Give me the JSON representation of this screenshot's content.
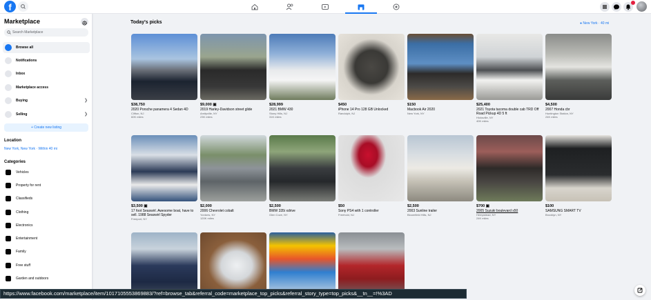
{
  "colors": {
    "brand": "#1877f2",
    "badge": "#e41e3f"
  },
  "topbar": {
    "logo": "f",
    "nav_icons": [
      "home-icon",
      "friends-icon",
      "watch-icon",
      "marketplace-icon",
      "gaming-icon"
    ],
    "right_icons": [
      "menu-icon",
      "messenger-icon",
      "notifications-icon",
      "profile-icon"
    ],
    "notification_count": "8"
  },
  "sidebar": {
    "title": "Marketplace",
    "search_placeholder": "Search Marketplace",
    "nav": [
      {
        "label": "Browse all",
        "active": true
      },
      {
        "label": "Notifications"
      },
      {
        "label": "Inbox"
      },
      {
        "label": "Marketplace access"
      },
      {
        "label": "Buying",
        "chevron": true
      },
      {
        "label": "Selling",
        "chevron": true
      }
    ],
    "create_label": "+ Create new listing",
    "location_heading": "Location",
    "location_value": "New York, New York · Within 40 mi",
    "categories_heading": "Categories",
    "categories": [
      "Vehicles",
      "Property for rent",
      "Classifieds",
      "Clothing",
      "Electronics",
      "Entertainment",
      "Family",
      "Free stuff",
      "Garden and outdoors"
    ]
  },
  "main": {
    "title": "Today's picks",
    "location_link": "New York · 40 mi",
    "listings": [
      {
        "price": "$38,750",
        "title": "2020 Porsche panamera 4 Sedan 4D",
        "location": "Clifton, NJ",
        "mileage": "60K miles"
      },
      {
        "price": "$9,000",
        "title": "2019 Harley-Davidson street glide",
        "location": "Amityville, NY",
        "mileage": "23K miles"
      },
      {
        "price": "$28,999",
        "title": "2021 BMW 430",
        "location": "Stony Hills, NJ",
        "mileage": "31K miles"
      },
      {
        "price": "$450",
        "title": "iPhone 14 Pro 128 GB Unlocked",
        "location": "Randolph, NJ",
        "mileage": ""
      },
      {
        "price": "$150",
        "title": "Macbook Air 2020",
        "location": "New York, NY",
        "mileage": ""
      },
      {
        "price": "$25,400",
        "title": "2021 Toyota tacoma double cab TRD Off Road Pickup 4D 5 ft",
        "location": "Hicksville, NY",
        "mileage": "40K miles"
      },
      {
        "price": "$4,500",
        "title": "2007 Honda cbr",
        "location": "Huntington Station, NY",
        "mileage": "24K miles"
      },
      {
        "price": "$3,500",
        "title": "17 foot Seaswirl. Awesome boat, have to sell. 1988 Seaswirl Spyder",
        "location": "Freeport, NY",
        "mileage": ""
      },
      {
        "price": "$2,000",
        "title": "2006 Chevrolet cobalt",
        "location": "Yonkers, NY",
        "mileage": "120K miles"
      },
      {
        "price": "$2,500",
        "title": "BMW 335i xdrive",
        "location": "Glen Cove, NY",
        "mileage": ""
      },
      {
        "price": "$50",
        "title": "Sony PS4 with 1 controller",
        "location": "Freehold, NJ",
        "mileage": ""
      },
      {
        "price": "$2,500",
        "title": "2003 Sunline trailer",
        "location": "Bloomfield Hills, NJ",
        "mileage": ""
      },
      {
        "price": "$700",
        "title": "2005 Suzuki boulevard s50",
        "location": "Hempstead, NY",
        "mileage": "24K miles"
      },
      {
        "price": "$100",
        "title": "SAMSUNG SMART TV",
        "location": "Brooklyn, NY",
        "mileage": ""
      },
      {
        "price": "",
        "title": "",
        "location": "",
        "mileage": ""
      },
      {
        "price": "",
        "title": "",
        "location": "",
        "mileage": ""
      },
      {
        "price": "",
        "title": "",
        "location": "",
        "mileage": ""
      },
      {
        "price": "",
        "title": "",
        "location": "",
        "mileage": ""
      }
    ]
  },
  "statusbar": {
    "url": "https://www.facebook.com/marketplace/item/1017105553869883/?ref=browse_tab&referral_code=marketplace_top_picks&referral_story_type=top_picks&__tn__=!%3AD"
  }
}
